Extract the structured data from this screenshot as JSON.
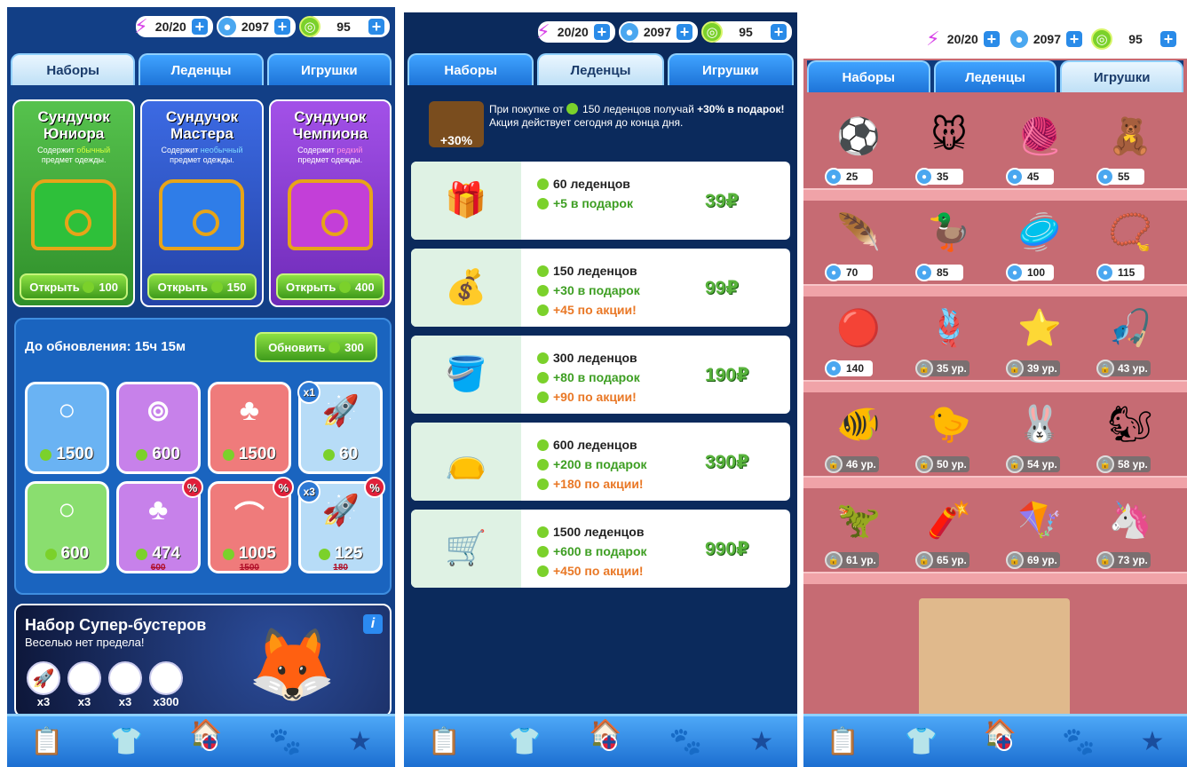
{
  "resources": {
    "energy": "20/20",
    "coins": "2097",
    "candies": "95"
  },
  "tabs": [
    "Наборы",
    "Леденцы",
    "Игрушки"
  ],
  "chests": [
    {
      "title1": "Сундучок",
      "title2": "Юниора",
      "desc_a": "Содержит ",
      "desc_kind": "обычный",
      "desc_b": "предмет одежды.",
      "button": "Открыть",
      "price": "100",
      "color": "#3fb03a"
    },
    {
      "title1": "Сундучок",
      "title2": "Мастера",
      "desc_a": "Содержит ",
      "desc_kind": "необычный",
      "desc_b": "предмет одежды.",
      "button": "Открыть",
      "price": "150",
      "color": "#2f55c9"
    },
    {
      "title1": "Сундучок",
      "title2": "Чемпиона",
      "desc_a": "Содержит ",
      "desc_kind": "редкий",
      "desc_b": "предмет одежды.",
      "button": "Открыть",
      "price": "400",
      "color": "#8a3fd6"
    }
  ],
  "offers": {
    "timer": "До обновления: 15ч 15м",
    "refresh_label": "Обновить",
    "refresh_price": "300",
    "items": [
      {
        "price": "1500",
        "color": "c-blue",
        "icon": "○",
        "mult": "",
        "disc": "",
        "old": ""
      },
      {
        "price": "600",
        "color": "c-pur",
        "icon": "⊚",
        "mult": "",
        "disc": "",
        "old": ""
      },
      {
        "price": "1500",
        "color": "c-red",
        "icon": "♣",
        "mult": "",
        "disc": "",
        "old": ""
      },
      {
        "price": "60",
        "color": "c-lb",
        "icon": "🚀",
        "mult": "x1",
        "disc": "",
        "old": ""
      },
      {
        "price": "600",
        "color": "c-grn",
        "icon": "○",
        "mult": "",
        "disc": "",
        "old": ""
      },
      {
        "price": "474",
        "color": "c-pur",
        "icon": "♣",
        "mult": "",
        "disc": "%",
        "old": "600"
      },
      {
        "price": "1005",
        "color": "c-red",
        "icon": "⌒",
        "mult": "",
        "disc": "%",
        "old": "1500"
      },
      {
        "price": "125",
        "color": "c-lb",
        "icon": "🚀",
        "mult": "x3",
        "disc": "%",
        "old": "180"
      }
    ]
  },
  "super": {
    "title": "Набор Супер-бустеров",
    "subtitle": "Веселью нет предела!",
    "info": "i",
    "boosters": [
      {
        "icon": "🚀",
        "qty": "x3"
      },
      {
        "icon": "✸",
        "qty": "x3"
      },
      {
        "icon": "▤",
        "qty": "x3"
      },
      {
        "icon": "◎",
        "qty": "x300"
      }
    ]
  },
  "promo": {
    "text_a": "При покупке от ",
    "amount": "150",
    "text_b": " леденцов получай ",
    "bonus": "+30% в подарок!",
    "text_c": "Акция действует сегодня до конца дня.",
    "badge": "+30%"
  },
  "packs": [
    {
      "l1": "60 леденцов",
      "l2": "+5 в подарок",
      "l3": "",
      "price": "39₽",
      "icon": "🎁"
    },
    {
      "l1": "150 леденцов",
      "l2": "+30 в подарок",
      "l3": "+45 по акции!",
      "price": "99₽",
      "icon": "💰"
    },
    {
      "l1": "300 леденцов",
      "l2": "+80 в подарок",
      "l3": "+90 по акции!",
      "price": "190₽",
      "icon": "🪣"
    },
    {
      "l1": "600 леденцов",
      "l2": "+200 в подарок",
      "l3": "+180 по акции!",
      "price": "390₽",
      "icon": "👝"
    },
    {
      "l1": "1500 леденцов",
      "l2": "+600 в подарок",
      "l3": "+450 по акции!",
      "price": "990₽",
      "icon": "🛒"
    }
  ],
  "toys": [
    [
      {
        "i": "⚽",
        "t": "25",
        "l": false
      },
      {
        "i": "🐭",
        "t": "35",
        "l": false
      },
      {
        "i": "🧶",
        "t": "45",
        "l": false
      },
      {
        "i": "🧸",
        "t": "55",
        "l": false
      }
    ],
    [
      {
        "i": "🪶",
        "t": "70",
        "l": false
      },
      {
        "i": "🦆",
        "t": "85",
        "l": false
      },
      {
        "i": "🥏",
        "t": "100",
        "l": false
      },
      {
        "i": "📿",
        "t": "115",
        "l": false
      }
    ],
    [
      {
        "i": "🔴",
        "t": "140",
        "l": false
      },
      {
        "i": "🪢",
        "t": "35 ур.",
        "l": true
      },
      {
        "i": "⭐",
        "t": "39 ур.",
        "l": true
      },
      {
        "i": "🎣",
        "t": "43 ур.",
        "l": true
      }
    ],
    [
      {
        "i": "🐠",
        "t": "46 ур.",
        "l": true
      },
      {
        "i": "🐤",
        "t": "50 ур.",
        "l": true
      },
      {
        "i": "🐰",
        "t": "54 ур.",
        "l": true
      },
      {
        "i": "🐿",
        "t": "58 ур.",
        "l": true
      }
    ],
    [
      {
        "i": "🦖",
        "t": "61 ур.",
        "l": true
      },
      {
        "i": "🧨",
        "t": "65 ур.",
        "l": true
      },
      {
        "i": "🪁",
        "t": "69 ур.",
        "l": true
      },
      {
        "i": "🦄",
        "t": "73 ур.",
        "l": true
      }
    ]
  ],
  "nav": {
    "icons": [
      "📋",
      "👕",
      "🏠",
      "🐾",
      "★"
    ],
    "badge": "+"
  }
}
